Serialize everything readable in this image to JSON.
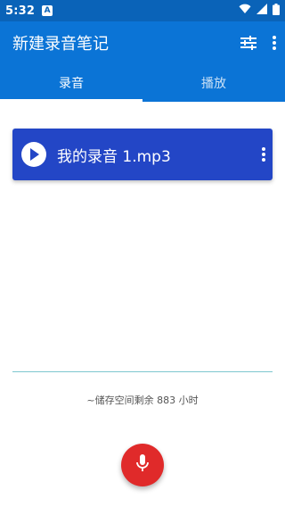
{
  "status_bar": {
    "time": "5:32",
    "badge": "A",
    "icons": [
      "wifi-icon",
      "signal-icon",
      "battery-icon"
    ]
  },
  "app_bar": {
    "title": "新建录音笔记",
    "actions": [
      "tune-icon",
      "more-vert-icon"
    ]
  },
  "tabs": [
    {
      "label": "录音",
      "active": true
    },
    {
      "label": "播放",
      "active": false
    }
  ],
  "recording": {
    "name": "我的录音 1.mp3"
  },
  "storage_text": "~储存空间剩余 883 小时",
  "colors": {
    "app_bar": "#0b74d6",
    "status_bar": "#0a63b8",
    "card": "#2346c6",
    "fab": "#e02a2a",
    "divider": "#7fc7cf"
  }
}
